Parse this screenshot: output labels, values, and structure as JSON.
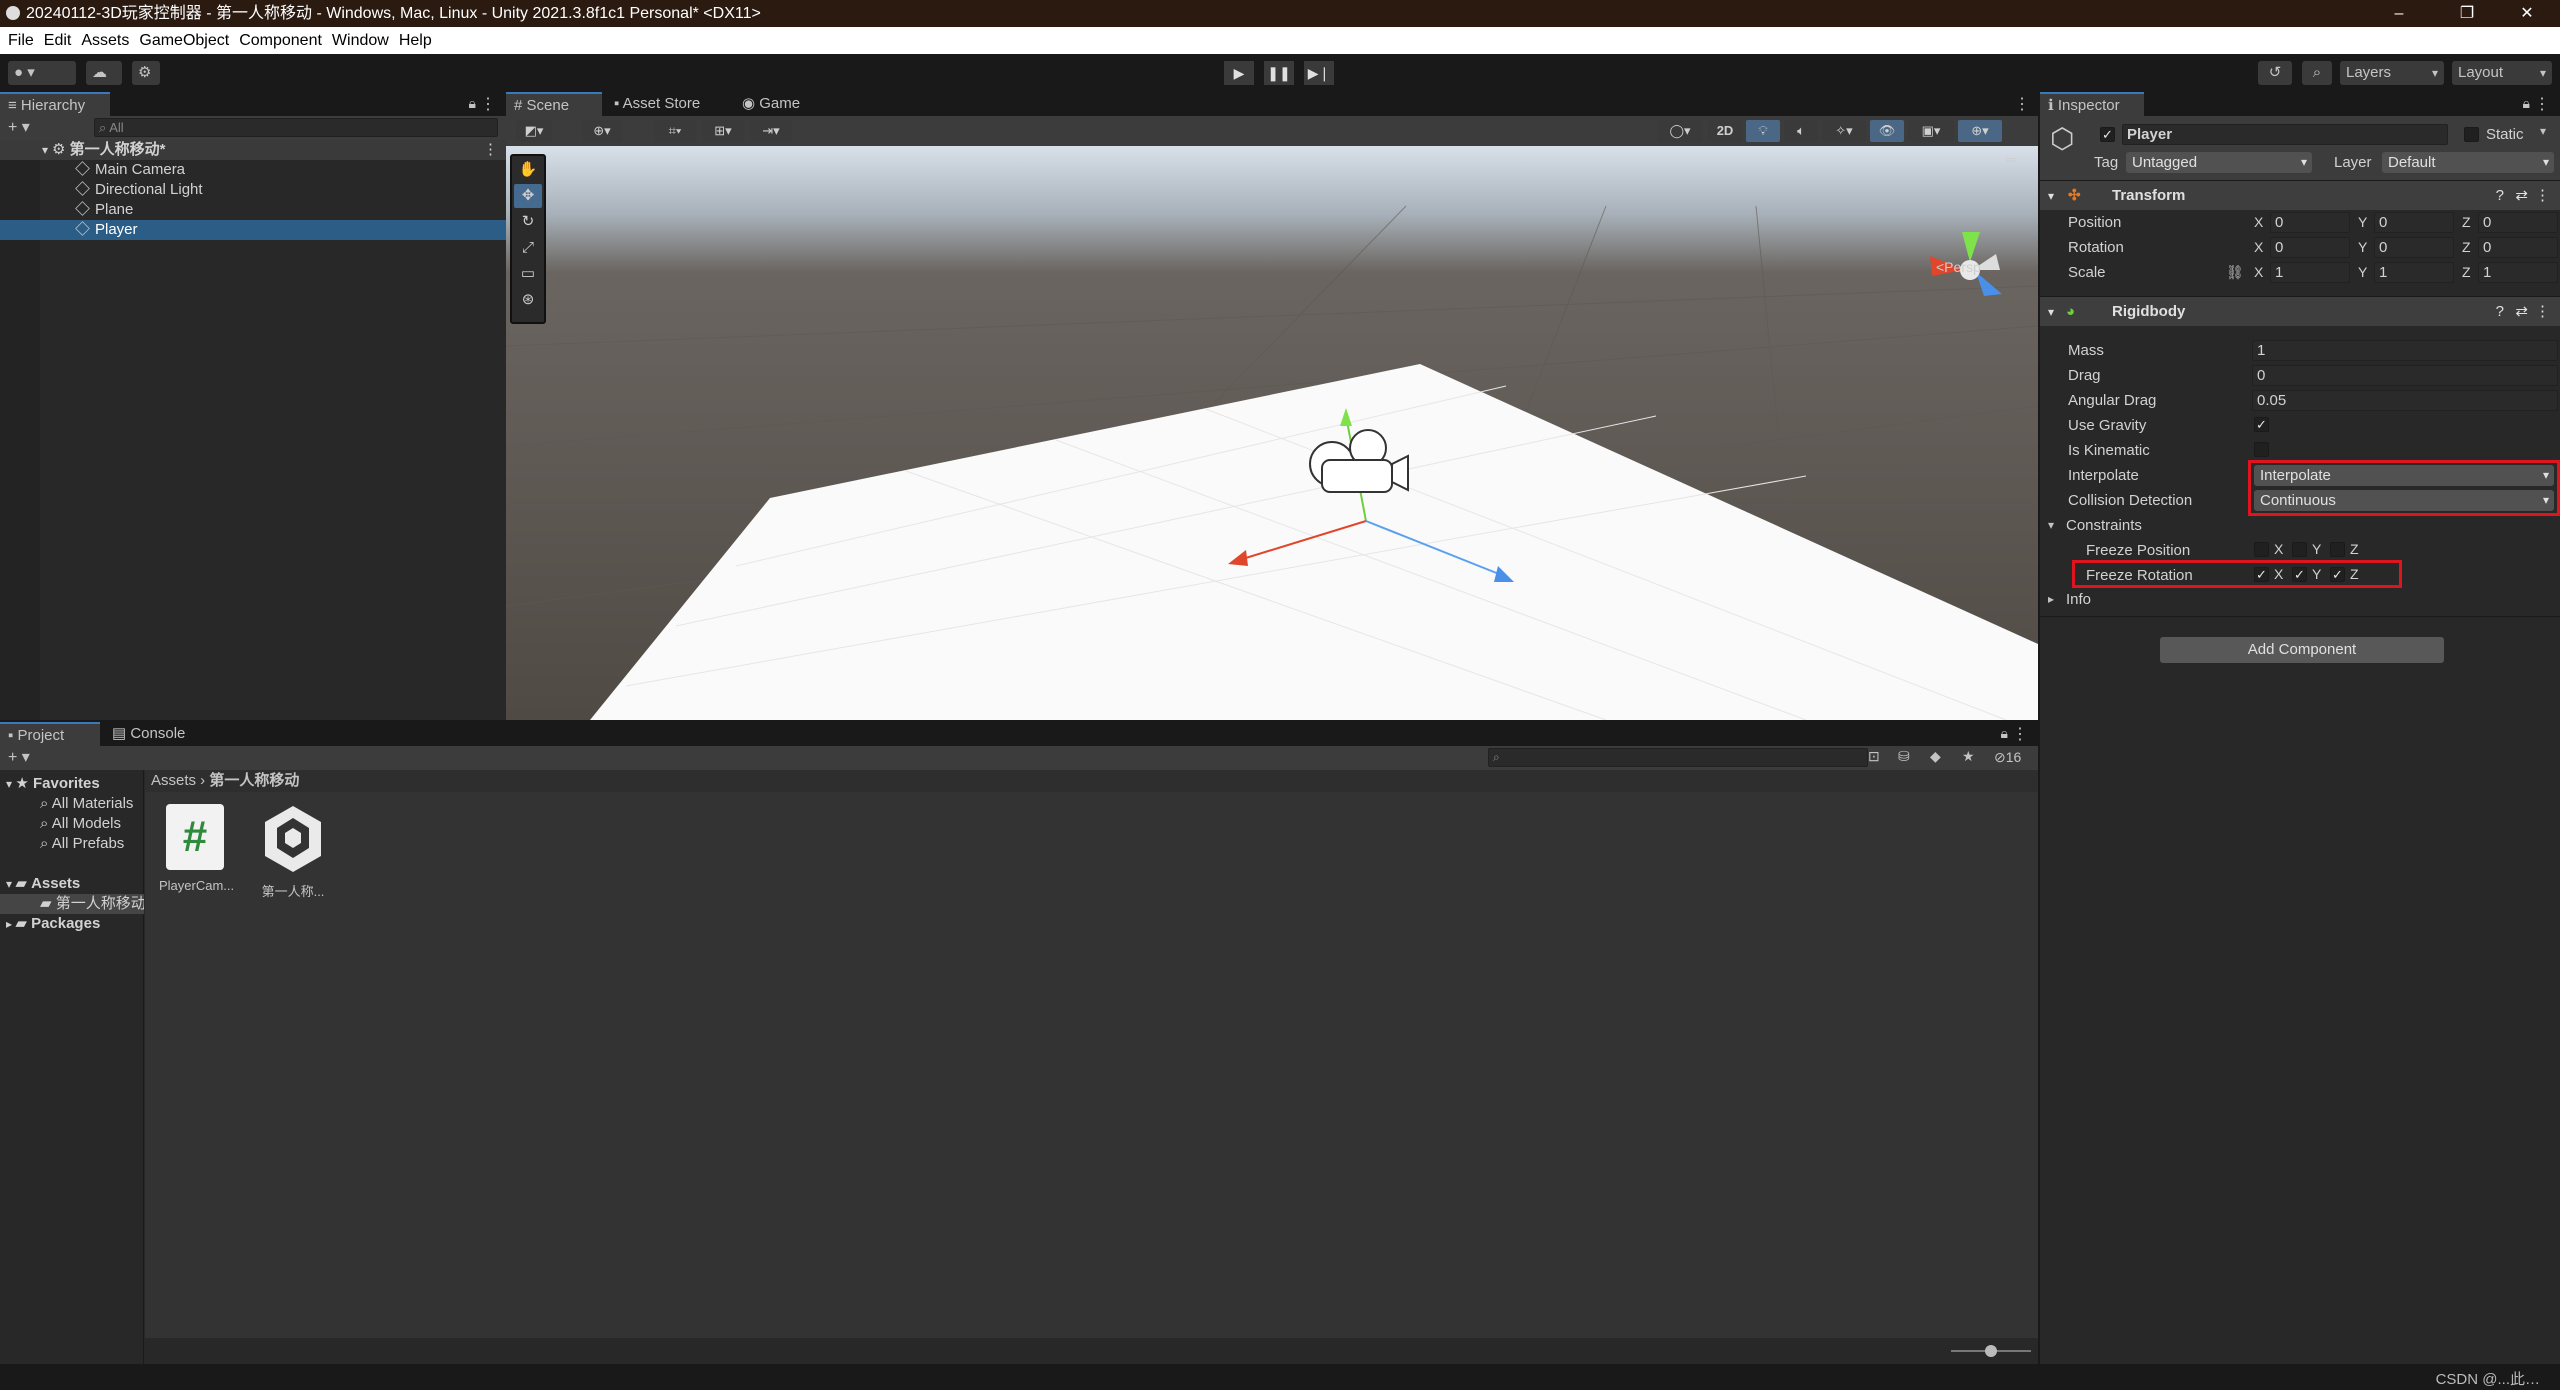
{
  "window": {
    "title": "20240112-3D玩家控制器 - 第一人称移动 - Windows, Mac, Linux - Unity 2021.3.8f1c1 Personal* <DX11>",
    "minimize": "–",
    "maximize": "❐",
    "close": "✕"
  },
  "menu": [
    "File",
    "Edit",
    "Assets",
    "GameObject",
    "Component",
    "Window",
    "Help"
  ],
  "toolbar": {
    "account_icon": "account-icon",
    "cloud_icon": "cloud-icon",
    "collab_icon": "collab-icon",
    "play": "▶",
    "pause": "❚❚",
    "step": "▶❘",
    "history_icon": "history-icon",
    "search_icon": "search-icon",
    "layers": "Layers",
    "layout": "Layout"
  },
  "hierarchy": {
    "tab": "Hierarchy",
    "add": "+ ▾",
    "search_placeholder": "All",
    "scene": "第一人称移动*",
    "items": [
      "Main Camera",
      "Directional Light",
      "Plane",
      "Player"
    ],
    "selected": "Player"
  },
  "scene_view": {
    "tabs": [
      "Scene",
      "Asset Store",
      "Game"
    ],
    "active_tab": "Scene",
    "toggle_2d": "2D",
    "persp": "<Persp"
  },
  "project": {
    "tabs": [
      "Project",
      "Console"
    ],
    "add": "+ ▾",
    "hidden_count": "16",
    "breadcrumb": [
      "Assets",
      "第一人称移动"
    ],
    "favorites_label": "Favorites",
    "favorites": [
      "All Materials",
      "All Models",
      "All Prefabs"
    ],
    "assets_label": "Assets",
    "assets_children": [
      "第一人称移动"
    ],
    "packages_label": "Packages",
    "files": [
      {
        "name": "PlayerCam...",
        "icon": "#"
      },
      {
        "name": "第一人称..."
      }
    ]
  },
  "inspector": {
    "tab": "Inspector",
    "object_name": "Player",
    "static_label": "Static",
    "tag_label": "Tag",
    "tag_value": "Untagged",
    "layer_label": "Layer",
    "layer_value": "Default",
    "transform": {
      "title": "Transform",
      "rows": [
        {
          "label": "Position",
          "x": "0",
          "y": "0",
          "z": "0"
        },
        {
          "label": "Rotation",
          "x": "0",
          "y": "0",
          "z": "0"
        },
        {
          "label": "Scale",
          "x": "1",
          "y": "1",
          "z": "1"
        }
      ]
    },
    "rigidbody": {
      "title": "Rigidbody",
      "mass_label": "Mass",
      "mass": "1",
      "drag_label": "Drag",
      "drag": "0",
      "angular_drag_label": "Angular Drag",
      "angular_drag": "0.05",
      "use_gravity_label": "Use Gravity",
      "use_gravity": true,
      "is_kinematic_label": "Is Kinematic",
      "is_kinematic": false,
      "interpolate_label": "Interpolate",
      "interpolate": "Interpolate",
      "collision_label": "Collision Detection",
      "collision": "Continuous",
      "constraints_label": "Constraints",
      "freeze_position_label": "Freeze Position",
      "freeze_rotation_label": "Freeze Rotation",
      "info_label": "Info",
      "axis_labels": [
        "X",
        "Y",
        "Z"
      ]
    },
    "add_component": "Add Component"
  },
  "watermark": "CSDN @...此…"
}
